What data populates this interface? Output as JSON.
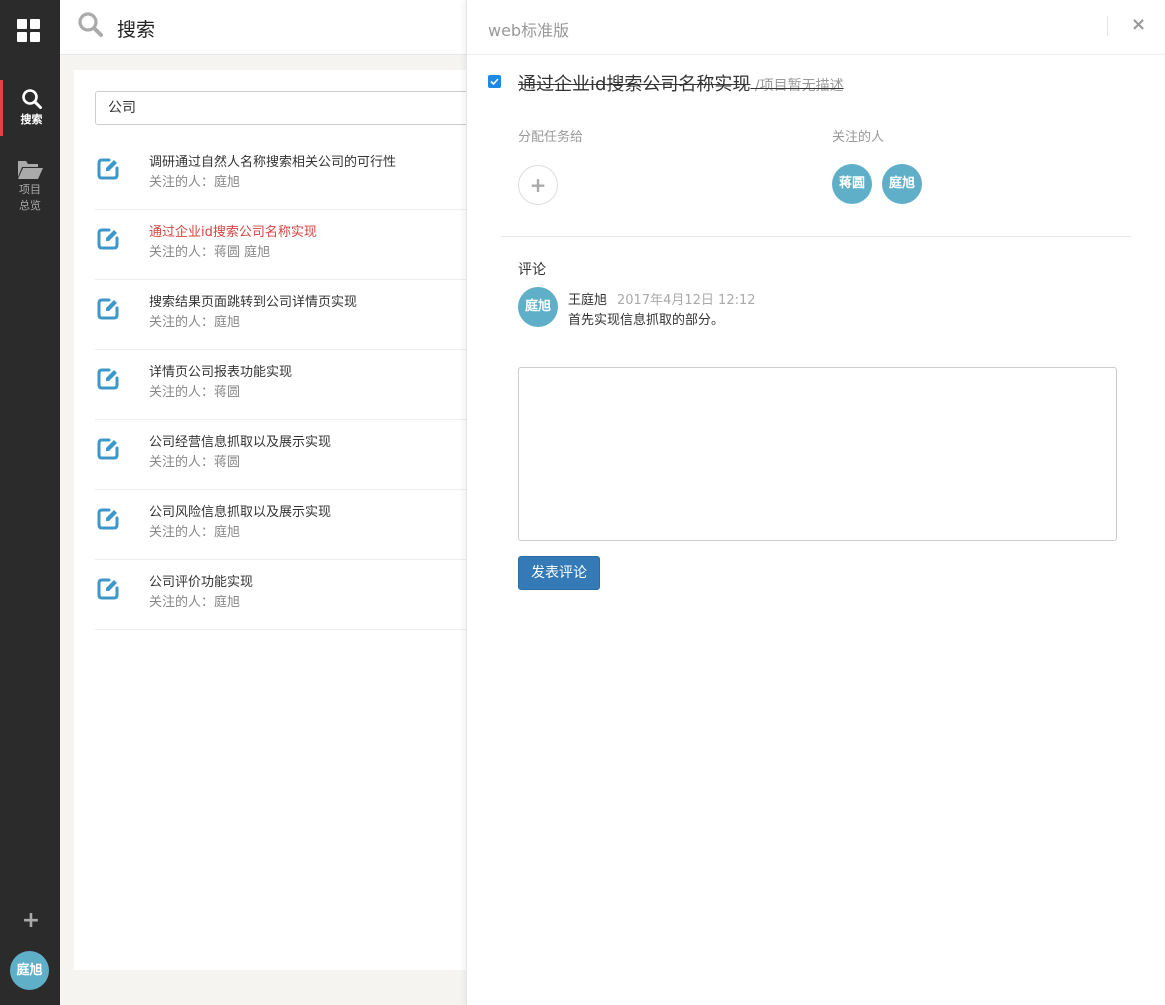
{
  "nav": {
    "search_label": "搜索",
    "projects_label_1": "项目",
    "projects_label_2": "总览",
    "add": "+",
    "user_avatar": "庭旭",
    "accent": "#e3423f"
  },
  "search": {
    "title": "搜索",
    "query": "公司",
    "results": [
      {
        "title": "调研通过自然人名称搜索相关公司的可行性",
        "followers": "关注的人：庭旭",
        "highlight": false
      },
      {
        "title": "通过企业id搜索公司名称实现",
        "followers": "关注的人：蒋圆 庭旭",
        "highlight": true
      },
      {
        "title": "搜索结果页面跳转到公司详情页实现",
        "followers": "关注的人：庭旭",
        "highlight": false
      },
      {
        "title": "详情页公司报表功能实现",
        "followers": "关注的人：蒋圆",
        "highlight": false
      },
      {
        "title": "公司经营信息抓取以及展示实现",
        "followers": "关注的人：蒋圆",
        "highlight": false
      },
      {
        "title": "公司风险信息抓取以及展示实现",
        "followers": "关注的人：庭旭",
        "highlight": false
      },
      {
        "title": "公司评价功能实现",
        "followers": "关注的人：庭旭",
        "highlight": false
      }
    ]
  },
  "detail": {
    "project_name": "web标准版",
    "close": "×",
    "task_title": "通过企业id搜索公司名称实现",
    "task_desc": " /项目暂无描述",
    "completed": true,
    "assign_label": "分配任务给",
    "assign_add": "+",
    "followers_label": "关注的人",
    "followers": [
      "蒋圆",
      "庭旭"
    ],
    "comments_label": "评论",
    "comments": [
      {
        "avatar": "庭旭",
        "author": "王庭旭",
        "time": "2017年4月12日 12:12",
        "text": "首先实现信息抓取的部分。"
      }
    ],
    "submit_label": "发表评论",
    "avatar_color": "#5fafc9",
    "button_color": "#337ab7"
  }
}
